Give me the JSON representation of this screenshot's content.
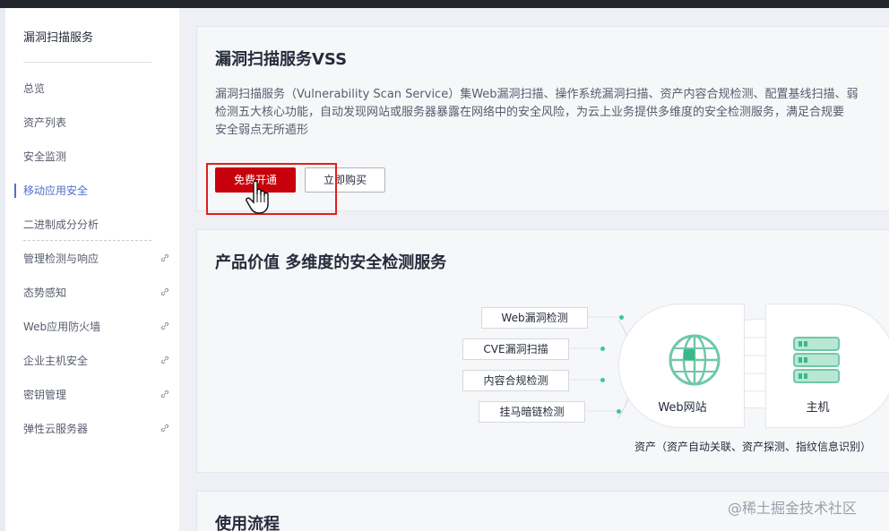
{
  "sidebar": {
    "title": "漏洞扫描服务",
    "items": [
      {
        "label": "总览",
        "external": false
      },
      {
        "label": "资产列表",
        "external": false
      },
      {
        "label": "安全监测",
        "external": false
      },
      {
        "label": "移动应用安全",
        "external": false,
        "active": true
      },
      {
        "label": "二进制成分分析",
        "external": false
      },
      {
        "label": "管理检测与响应",
        "external": true
      },
      {
        "label": "态势感知",
        "external": true
      },
      {
        "label": "Web应用防火墙",
        "external": true
      },
      {
        "label": "企业主机安全",
        "external": true
      },
      {
        "label": "密钥管理",
        "external": true
      },
      {
        "label": "弹性云服务器",
        "external": true
      }
    ]
  },
  "intro": {
    "title": "漏洞扫描服务VSS",
    "desc_lines": [
      "漏洞扫描服务（Vulnerability Scan Service）集Web漏洞扫描、操作系统漏洞扫描、资产内容合规检测、配置基线扫描、弱",
      "检测五大核心功能，自动发现网站或服务器暴露在网络中的安全风险，为云上业务提供多维度的安全检测服务，满足合规要",
      "安全弱点无所遁形"
    ],
    "primary_button": "免费开通",
    "secondary_button": "立即购买"
  },
  "value": {
    "title": "产品价值 多维度的安全检测服务",
    "features": [
      "Web漏洞检测",
      "CVE漏洞扫描",
      "内容合规检测",
      "挂马暗链检测"
    ],
    "assets": [
      "Web网站",
      "主机"
    ],
    "caption": "资产（资产自动关联、资产探测、指纹信息识别）"
  },
  "process": {
    "title": "使用流程"
  },
  "watermark": "@稀土掘金技术社区",
  "colors": {
    "accent": "#526ecc",
    "brand_red": "#c7000b",
    "highlight": "#e0201d",
    "node_green": "#3bc7a1"
  }
}
